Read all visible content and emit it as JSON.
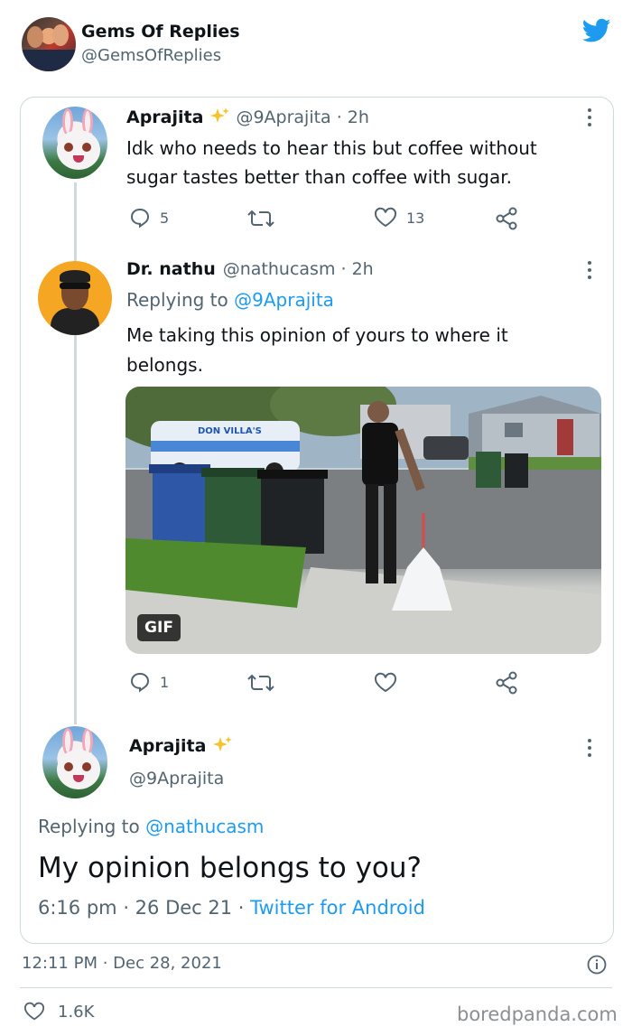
{
  "outer": {
    "name": "Gems Of Replies",
    "handle": "@GemsOfReplies"
  },
  "tweet1": {
    "name": "Aprajita",
    "handle_time": "@9Aprajita · 2h",
    "text_line1": "Idk who needs to hear this but coffee without",
    "text_line2": "sugar tastes better than coffee with sugar.",
    "replies": "5",
    "likes": "13"
  },
  "tweet2": {
    "name": "Dr. nathu",
    "handle_time": "@nathucasm · 2h",
    "replying_prefix": "Replying to",
    "replying_to": "@9Aprajita",
    "text_line1": "Me taking this opinion of yours to where it",
    "text_line2": "belongs.",
    "gif_label": "GIF",
    "van_text": "DON VILLA'S",
    "replies": "1"
  },
  "tweet3": {
    "name": "Aprajita",
    "handle": "@9Aprajita",
    "replying_prefix": "Replying to",
    "replying_to": "@nathucasm",
    "text": "My opinion belongs to you?",
    "time": "6:16 pm",
    "date": "26 Dec 21",
    "source": "Twitter for Android"
  },
  "footer": {
    "timestamp": "12:11 PM · Dec 28, 2021",
    "likes": "1.6K",
    "watermark": "boredpanda.com"
  },
  "colors": {
    "twitter_blue": "#1d9bf0",
    "text": "#0f1419",
    "muted": "#536471",
    "border": "#cfd9de"
  }
}
